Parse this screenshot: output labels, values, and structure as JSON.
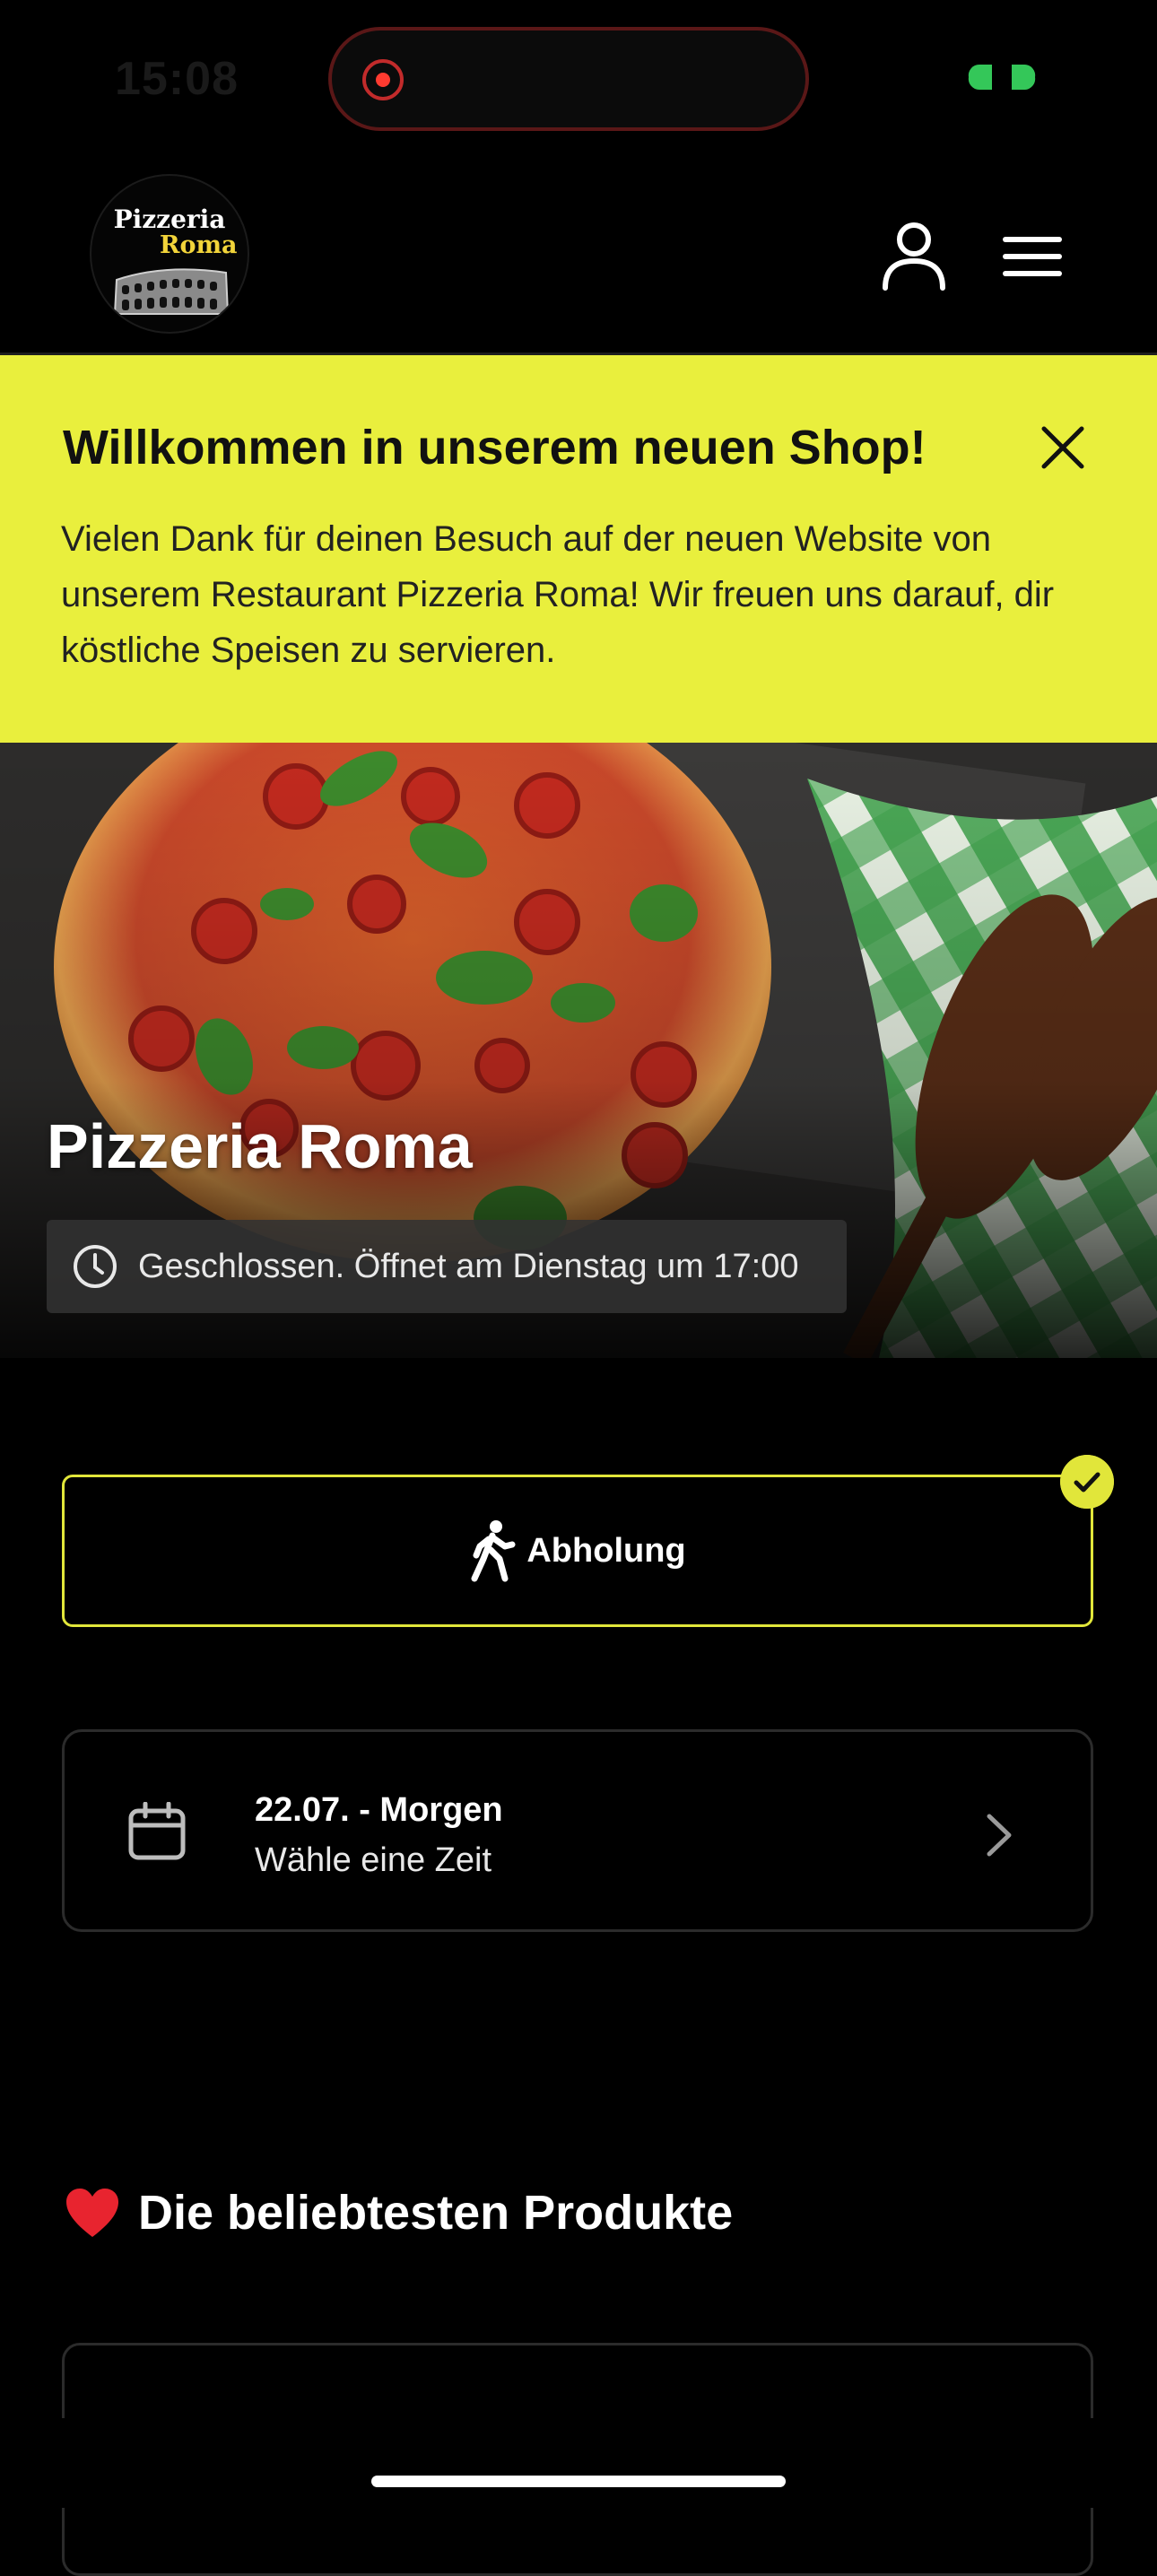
{
  "status_bar": {
    "time": "15:08",
    "recording_icon": "screen-recording-icon",
    "battery_icon": "battery-icon",
    "accent_color": "#34c759"
  },
  "header": {
    "logo": {
      "line1": "Pizzeria",
      "line2": "Roma",
      "image_icon": "colosseum-icon"
    },
    "account_icon": "user-icon",
    "menu_icon": "hamburger-menu-icon"
  },
  "banner": {
    "title": "Willkommen in unserem neuen Shop!",
    "text": "Vielen Dank für deinen Besuch auf der neuen Website von unserem Restaurant Pizzeria Roma! Wir freuen uns darauf, dir köstliche Speisen zu servieren.",
    "close_icon": "close-icon",
    "background_color": "#e9ef3d"
  },
  "hero": {
    "title": "Pizzeria Roma",
    "status": "Geschlossen. Öffnet am Dienstag um 17:00",
    "status_icon": "clock-icon"
  },
  "order_type": {
    "label": "Abholung",
    "icon": "walking-person-icon",
    "selected": true,
    "accent_color": "#e1e63a"
  },
  "date_selector": {
    "date": "22.07. - Morgen",
    "hint": "Wähle eine Zeit",
    "icon": "calendar-icon",
    "arrow_icon": "chevron-right-icon"
  },
  "popular": {
    "title": "Die beliebtesten Produkte",
    "icon": "heart-icon"
  }
}
